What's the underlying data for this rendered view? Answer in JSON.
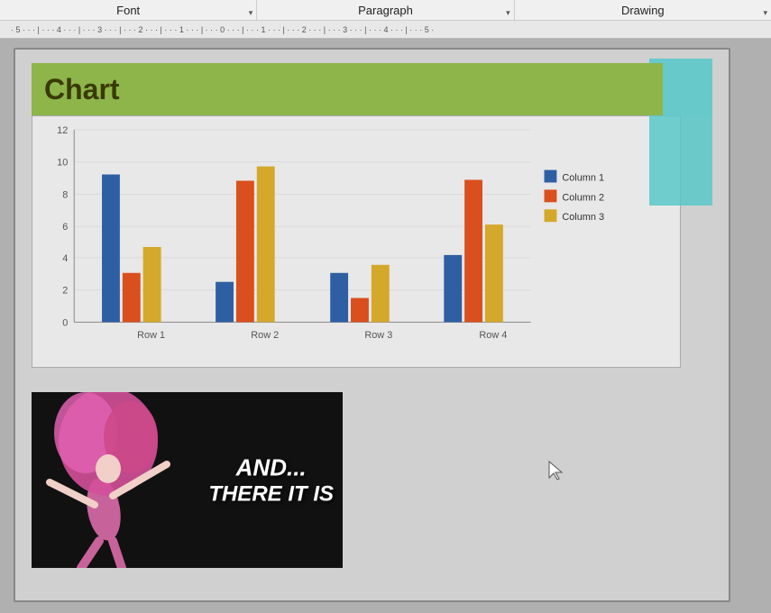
{
  "toolbar": {
    "sections": [
      {
        "label": "Font",
        "id": "font"
      },
      {
        "label": "Paragraph",
        "id": "paragraph"
      },
      {
        "label": "Drawing",
        "id": "drawing"
      }
    ]
  },
  "ruler": {
    "marks": [
      "-5",
      "-4",
      "-3",
      "-2",
      "-1",
      "0",
      "1",
      "2",
      "3",
      "4",
      "5"
    ]
  },
  "chart": {
    "title": "Chart",
    "title_bg": "#8db54a",
    "rows": [
      "Row 1",
      "Row 2",
      "Row 3",
      "Row 4"
    ],
    "columns": [
      "Column 1",
      "Column 2",
      "Column 3"
    ],
    "colors": [
      "#2e5fa3",
      "#d94f1e",
      "#d4a82a"
    ],
    "y_labels": [
      "0",
      "2",
      "4",
      "6",
      "8",
      "10",
      "12"
    ],
    "data": [
      [
        9.2,
        3.1,
        4.7
      ],
      [
        2.5,
        8.8,
        9.7
      ],
      [
        3.1,
        1.5,
        3.6
      ],
      [
        4.2,
        8.9,
        6.1
      ]
    ]
  },
  "image": {
    "text_line1": "AND...",
    "text_line2": "THERE IT IS"
  }
}
